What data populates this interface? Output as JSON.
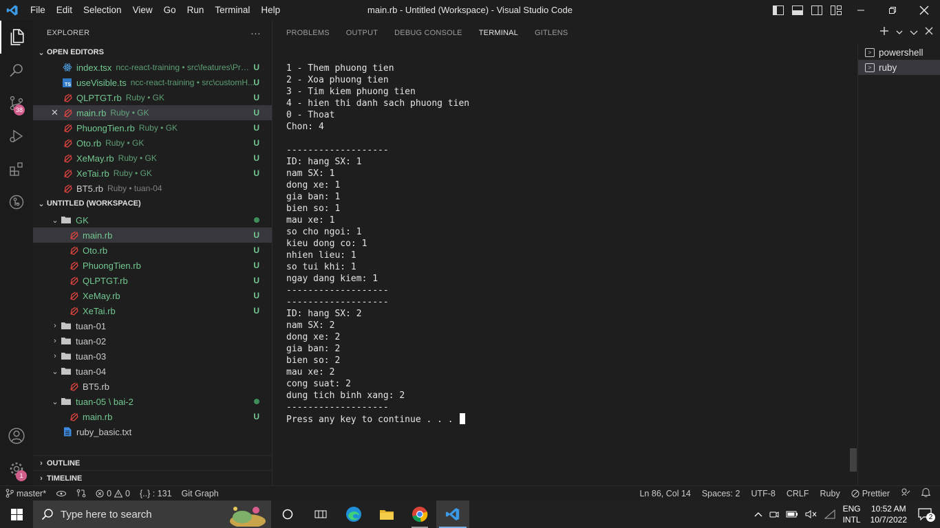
{
  "titlebar": {
    "menu": [
      "File",
      "Edit",
      "Selection",
      "View",
      "Go",
      "Run",
      "Terminal",
      "Help"
    ],
    "title": "main.rb - Untitled (Workspace) - Visual Studio Code"
  },
  "activity": {
    "scm_badge": "38",
    "settings_badge": "1"
  },
  "explorer": {
    "header": "EXPLORER",
    "more": "···",
    "open_editors_title": "OPEN EDITORS",
    "open_editors": [
      {
        "name": "index.tsx",
        "desc": "ncc-react-training • src\\features\\Proj...",
        "status": "U",
        "icon": "react-icon"
      },
      {
        "name": "useVisible.ts",
        "desc": "ncc-react-training • src\\customH...",
        "status": "U",
        "icon": "typescript-icon"
      },
      {
        "name": "QLPTGT.rb",
        "desc": "Ruby • GK",
        "status": "U",
        "icon": "ruby-icon"
      },
      {
        "name": "main.rb",
        "desc": "Ruby • GK",
        "status": "U",
        "icon": "ruby-icon"
      },
      {
        "name": "PhuongTien.rb",
        "desc": "Ruby • GK",
        "status": "U",
        "icon": "ruby-icon"
      },
      {
        "name": "Oto.rb",
        "desc": "Ruby • GK",
        "status": "U",
        "icon": "ruby-icon"
      },
      {
        "name": "XeMay.rb",
        "desc": "Ruby • GK",
        "status": "U",
        "icon": "ruby-icon"
      },
      {
        "name": "XeTai.rb",
        "desc": "Ruby • GK",
        "status": "U",
        "icon": "ruby-icon"
      },
      {
        "name": "BT5.rb",
        "desc": "Ruby • tuan-04",
        "status": "",
        "icon": "ruby-icon"
      }
    ],
    "close_glyph": "✕",
    "workspace_title": "UNTITLED (WORKSPACE)",
    "tree": {
      "gk": "GK",
      "gk_files": [
        {
          "name": "main.rb",
          "status": "U"
        },
        {
          "name": "Oto.rb",
          "status": "U"
        },
        {
          "name": "PhuongTien.rb",
          "status": "U"
        },
        {
          "name": "QLPTGT.rb",
          "status": "U"
        },
        {
          "name": "XeMay.rb",
          "status": "U"
        },
        {
          "name": "XeTai.rb",
          "status": "U"
        }
      ],
      "tuan01": "tuan-01",
      "tuan02": "tuan-02",
      "tuan03": "tuan-03",
      "tuan04": "tuan-04",
      "bt5": "BT5.rb",
      "tuan05": "tuan-05 \\ bai-2",
      "tuan05_main": "main.rb",
      "tuan05_main_status": "U",
      "ruby_basic": "ruby_basic.txt"
    },
    "outline": "OUTLINE",
    "timeline": "TIMELINE"
  },
  "panel": {
    "tabs": [
      "PROBLEMS",
      "OUTPUT",
      "DEBUG CONSOLE",
      "TERMINAL",
      "GITLENS"
    ],
    "active_tab": "TERMINAL",
    "terminal_lines": [
      "1 - Them phuong tien",
      "2 - Xoa phuong tien",
      "3 - Tim kiem phuong tien",
      "4 - hien thi danh sach phuong tien",
      "0 - Thoat",
      "Chon: 4",
      "",
      "-------------------",
      "ID: hang SX: 1",
      "nam SX: 1",
      "dong xe: 1",
      "gia ban: 1",
      "bien so: 1",
      "mau xe: 1",
      "so cho ngoi: 1",
      "kieu dong co: 1",
      "nhien lieu: 1",
      "so tui khi: 1",
      "ngay dang kiem: 1",
      "-------------------",
      "-------------------",
      "ID: hang SX: 2",
      "nam SX: 2",
      "dong xe: 2",
      "gia ban: 2",
      "bien so: 2",
      "mau xe: 2",
      "cong suat: 2",
      "dung tich binh xang: 2",
      "-------------------"
    ],
    "prompt": "Press any key to continue . . . ",
    "terminals": [
      "powershell",
      "ruby"
    ]
  },
  "statusbar": {
    "branch": "master*",
    "errors": "0",
    "warnings": "0",
    "symbols": "{..} : 131",
    "git_graph": "Git Graph",
    "position": "Ln 86, Col 14",
    "spaces": "Spaces: 2",
    "encoding": "UTF-8",
    "eol": "CRLF",
    "language": "Ruby",
    "prettier": "Prettier"
  },
  "taskbar": {
    "search_placeholder": "Type here to search",
    "lang_top": "ENG",
    "lang_bottom": "INTL",
    "time": "10:52 AM",
    "date": "10/7/2022",
    "notif_count": "2"
  }
}
